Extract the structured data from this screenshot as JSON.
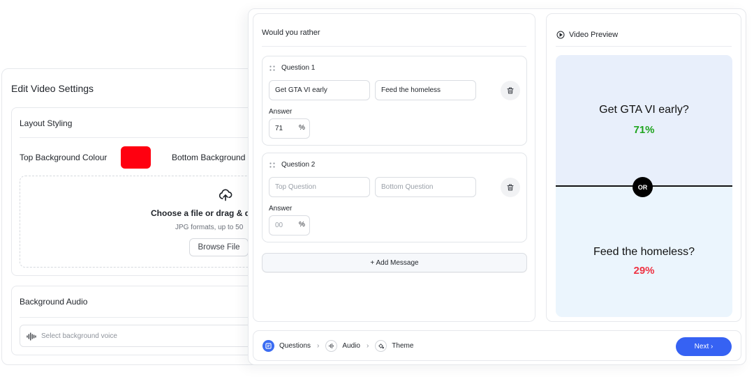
{
  "settings": {
    "title": "Edit Video Settings",
    "layout": {
      "title": "Layout Styling",
      "top_bg_label": "Top Background Colour",
      "top_bg_color": "#ff0010",
      "bottom_bg_label": "Bottom Background",
      "upload_title": "Choose a file or drag & dr",
      "upload_sub": "JPG formats, up to 50",
      "browse_label": "Browse File"
    },
    "audio": {
      "title": "Background Audio",
      "placeholder": "Select background voice"
    }
  },
  "editor": {
    "title": "Would you rather",
    "questions": [
      {
        "label": "Question 1",
        "top_value": "Get GTA VI early",
        "bottom_value": "Feed the homeless",
        "top_placeholder": "Top Question",
        "bottom_placeholder": "Bottom Question",
        "answer_label": "Answer",
        "answer_value": "71",
        "answer_placeholder": "00",
        "pct_symbol": "%"
      },
      {
        "label": "Question 2",
        "top_value": "",
        "bottom_value": "",
        "top_placeholder": "Top Question",
        "bottom_placeholder": "Bottom Question",
        "answer_label": "Answer",
        "answer_value": "",
        "answer_placeholder": "00",
        "pct_symbol": "%"
      }
    ],
    "add_message_label": "+ Add Message"
  },
  "preview": {
    "title": "Video Preview",
    "top_question": "Get GTA VI early?",
    "top_percent": "71%",
    "top_percent_color": "#1ea41e",
    "or_label": "OR",
    "bottom_question": "Feed the homeless?",
    "bottom_percent": "29%",
    "bottom_percent_color": "#ee3344"
  },
  "footer": {
    "steps": [
      {
        "label": "Questions",
        "icon": "questions-icon",
        "active": true
      },
      {
        "label": "Audio",
        "icon": "audio-icon",
        "active": false
      },
      {
        "label": "Theme",
        "icon": "paint-bucket-icon",
        "active": false
      }
    ],
    "next_label": "Next ›"
  }
}
